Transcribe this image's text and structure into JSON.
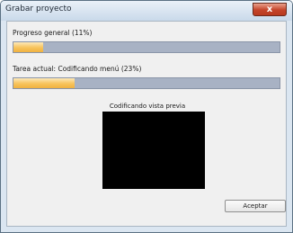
{
  "window": {
    "title": "Grabar proyecto",
    "close_label": "x"
  },
  "progress": {
    "overall_label": "Progreso general (11%)",
    "overall_fraction": 0.11,
    "task_label": "Tarea actual: Codificando menú  (23%)",
    "task_fraction": 0.23
  },
  "preview": {
    "title": "Codificando vista previa"
  },
  "buttons": {
    "accept_label": "Aceptar"
  }
}
